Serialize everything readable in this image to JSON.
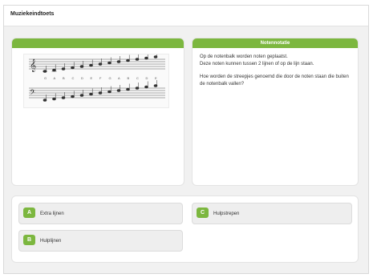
{
  "window": {
    "title": "Muziekeindtoets"
  },
  "panel_right": {
    "title": "Notennotatie",
    "line1": "Op de notenbalk worden noten geplaatst.",
    "line2": "Deze noten kunnen tussen 2 lijnen of op de lijn staan.",
    "question": "Hoe worden de streepjes genoemd die door de noten staan die buiten de notenbalk vallen?"
  },
  "staff": {
    "note_names": [
      "G",
      "A",
      "B",
      "C",
      "D",
      "E",
      "F",
      "G",
      "A",
      "B",
      "C",
      "D",
      "E"
    ]
  },
  "answers": [
    {
      "letter": "A",
      "label": "Extra lijnen"
    },
    {
      "letter": "B",
      "label": "Hulplijnen"
    },
    {
      "letter": "C",
      "label": "Hulpstrepen"
    }
  ],
  "colors": {
    "accent": "#7cb73f",
    "panel_bg": "#ffffff",
    "page_bg": "#f1f1f1"
  }
}
